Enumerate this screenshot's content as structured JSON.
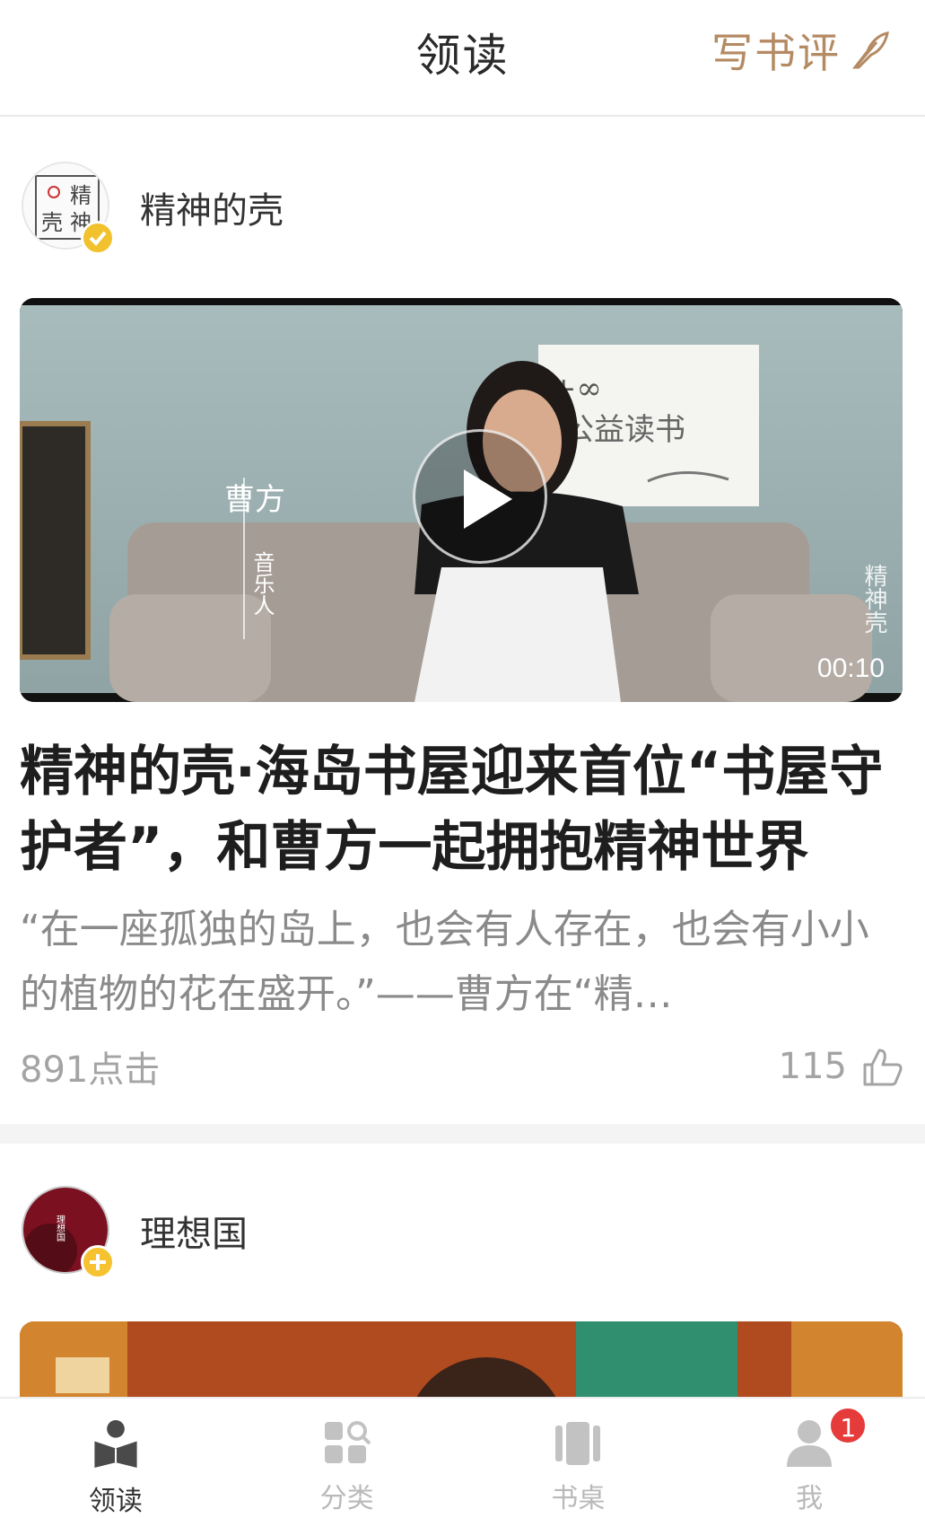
{
  "header": {
    "title": "领读",
    "write_review_label": "写书评"
  },
  "feed": {
    "post1": {
      "author_name": "精神的壳",
      "avatar_text": [
        "精",
        "神",
        "壳"
      ],
      "video_overlay": {
        "name": "曹方",
        "role": "音乐人",
        "sign_line1": "+∞",
        "sign_line2": "公益读书",
        "watermark": "精神壳"
      },
      "duration": "00:10",
      "title": "精神的壳·海岛书屋迎来首位“书屋守护者”，和曹方一起拥抱精神世界",
      "excerpt": "“在一座孤独的岛上，也会有人存在，也会有小小的植物的花在盛开。”——曹方在“精…",
      "clicks": "891点击",
      "likes": "115"
    },
    "post2": {
      "author_name": "理想国",
      "avatar_text": "理想国"
    }
  },
  "tabbar": {
    "items": [
      {
        "label": "领读",
        "icon": "book-open-icon",
        "active": true
      },
      {
        "label": "分类",
        "icon": "category-search-icon",
        "active": false
      },
      {
        "label": "书桌",
        "icon": "bookshelf-icon",
        "active": false
      },
      {
        "label": "我",
        "icon": "user-icon",
        "active": false,
        "badge": "1"
      }
    ]
  },
  "colors": {
    "accent": "#b48a63",
    "badge_verified": "#f2c12e",
    "notification": "#e53b3b"
  }
}
